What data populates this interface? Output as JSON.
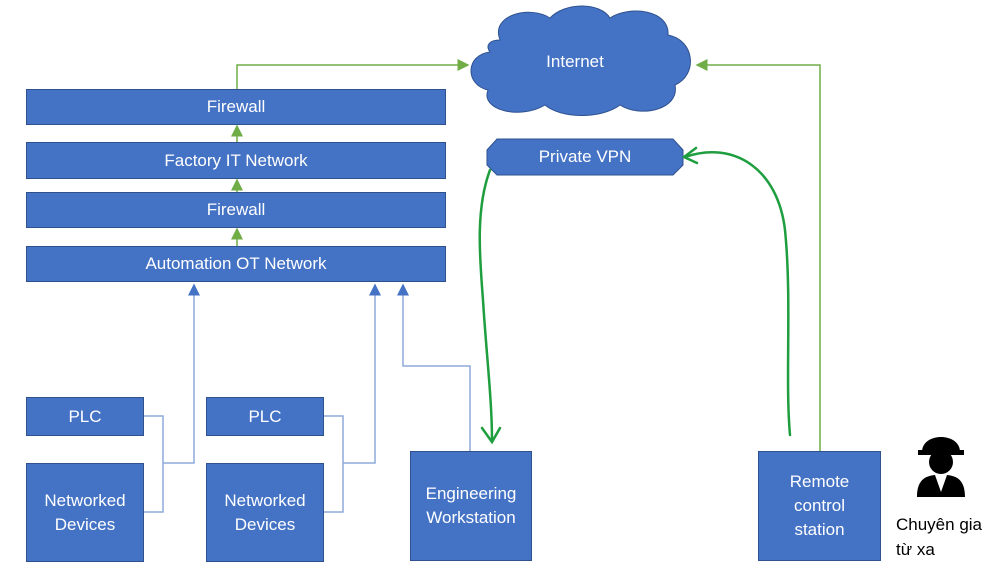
{
  "nodes": {
    "internet": "Internet",
    "private_vpn": "Private VPN",
    "firewall_top": "Firewall",
    "factory_it": "Factory IT Network",
    "firewall_mid": "Firewall",
    "automation_ot": "Automation OT Network",
    "plc_1": "PLC",
    "networked_devices_1": "Networked Devices",
    "plc_2": "PLC",
    "networked_devices_2": "Networked Devices",
    "engineering_ws": "Engineering Workstation",
    "remote_station": "Remote control station"
  },
  "person": {
    "icon": "engineer-hardhat-icon",
    "caption_line1": "Chuyên gia",
    "caption_line2": "từ xa"
  },
  "colors": {
    "box": "#4472c4",
    "link_blue": "#8faadc",
    "link_green": "#70ad47",
    "vpn_green": "#1e9e3e"
  }
}
